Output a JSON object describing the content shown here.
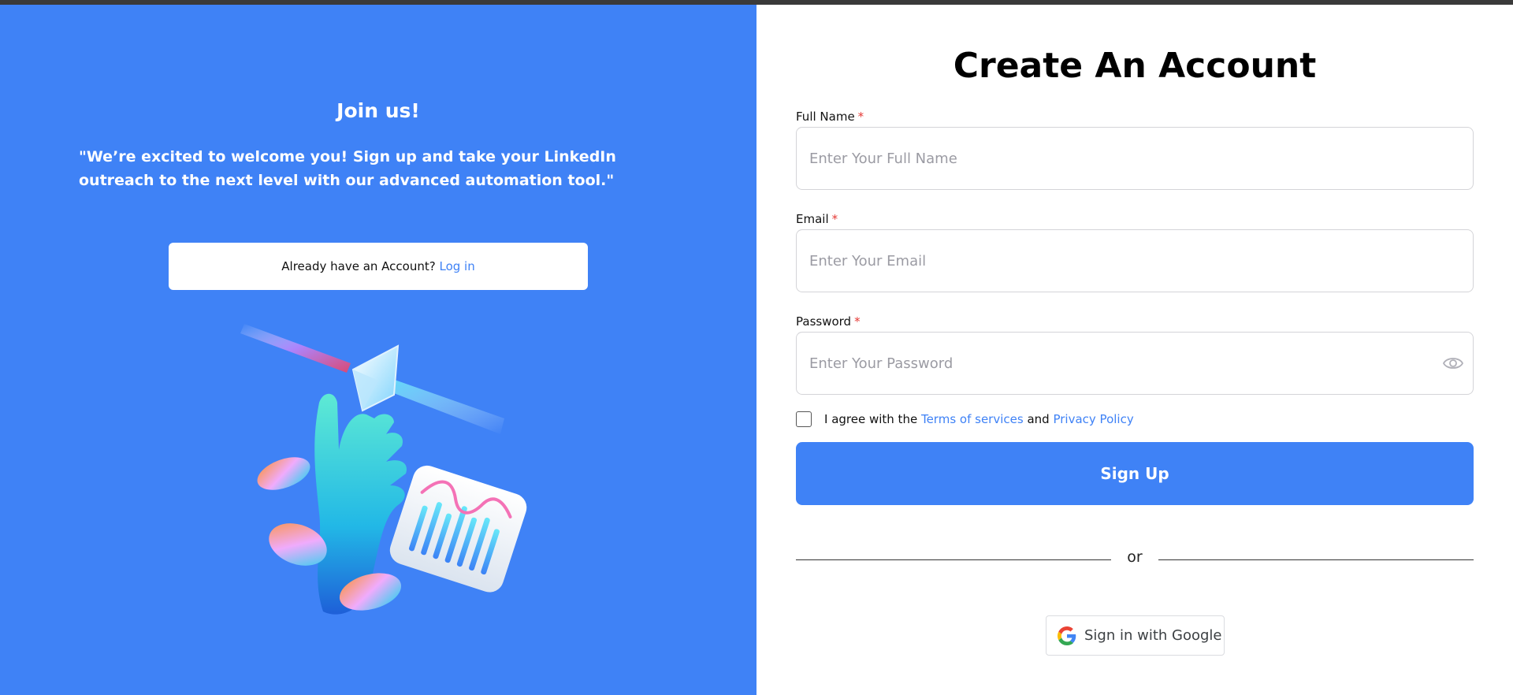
{
  "left_panel": {
    "title": "Join us!",
    "quote": "\"We’re excited to welcome you! Sign up and take your LinkedIn outreach to the next level with our advanced automation tool.\"",
    "login_prompt": "Already have an Account?",
    "login_link": "Log in",
    "illustration": "hand-crystal-chart-illustration"
  },
  "form": {
    "title": "Create An Account",
    "fields": {
      "full_name": {
        "label": "Full Name",
        "required_mark": "*",
        "placeholder": "Enter Your Full Name",
        "value": ""
      },
      "email": {
        "label": "Email",
        "required_mark": "*",
        "placeholder": "Enter Your Email",
        "value": ""
      },
      "password": {
        "label": "Password",
        "required_mark": "*",
        "placeholder": "Enter Your Password",
        "value": "",
        "toggle_icon": "eye-icon"
      }
    },
    "agree": {
      "prefix": "I agree with the",
      "terms_link": "Terms of services",
      "and": "and",
      "privacy_link": "Privacy Policy",
      "checked": false
    },
    "signup_button": "Sign Up",
    "divider_text": "or",
    "google_button": "Sign in with Google"
  },
  "colors": {
    "primary": "#3f82f6",
    "required": "#e53935",
    "topbar": "#3a3a3a"
  }
}
